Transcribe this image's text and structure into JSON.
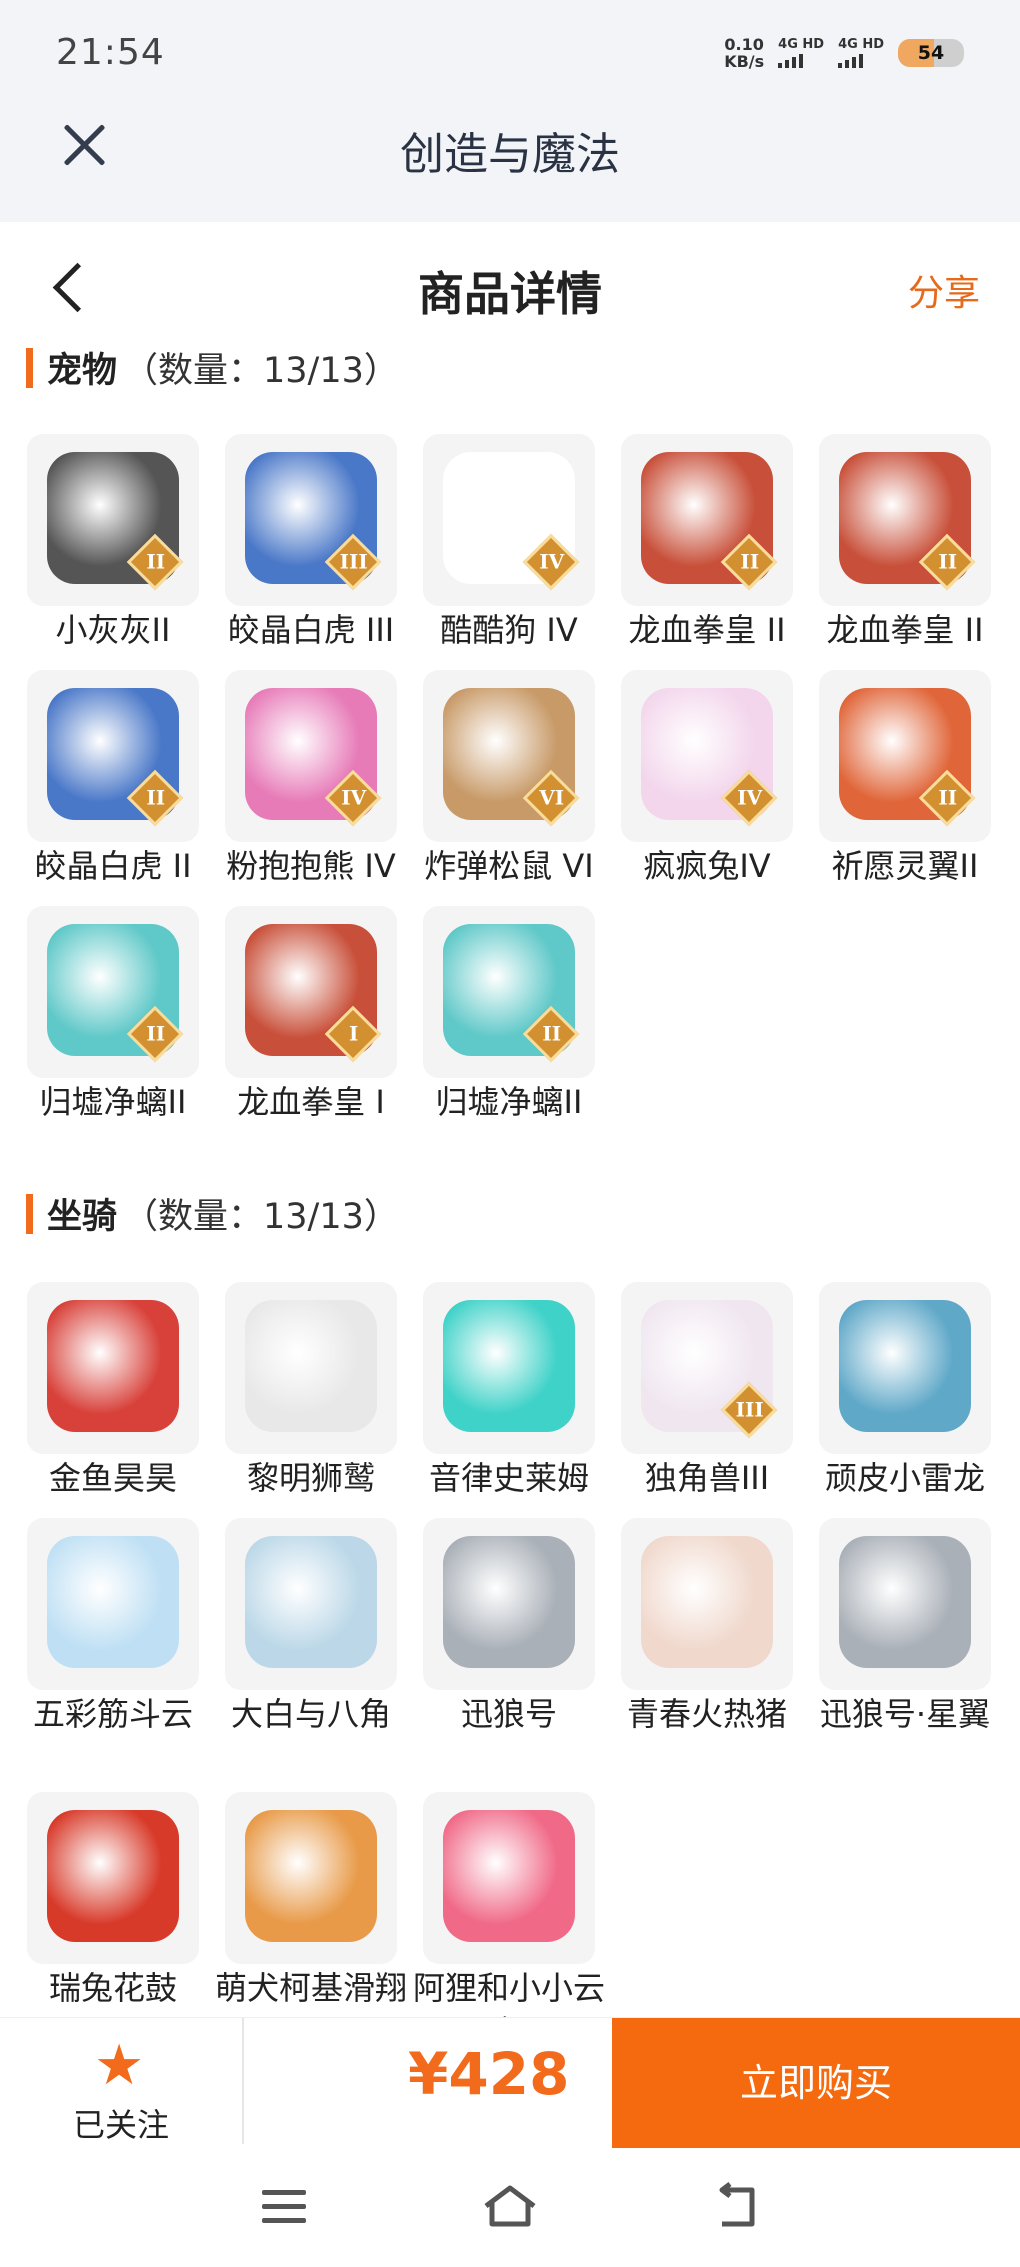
{
  "status_bar": {
    "time": "21:54",
    "net_speed": "0.10",
    "net_unit": "KB/s",
    "signal_1": "4G HD",
    "signal_2": "4G HD",
    "battery": "54",
    "battery_level": 0.54
  },
  "webview": {
    "title": "创造与魔法"
  },
  "header": {
    "title": "商品详情",
    "share": "分享"
  },
  "sections": [
    {
      "name": "宠物",
      "count": "（数量：13/13）",
      "items": [
        {
          "label": "小灰灰II",
          "badge": "II",
          "color": "#555555"
        },
        {
          "label": "皎晶白虎 III",
          "badge": "III",
          "color": "#4a78c8"
        },
        {
          "label": "酷酷狗 IV",
          "badge": "IV",
          "color": "#ffffff"
        },
        {
          "label": "龙血拳皇 II",
          "badge": "II",
          "color": "#c8503a"
        },
        {
          "label": "龙血拳皇 II",
          "badge": "II",
          "color": "#c8503a"
        },
        {
          "label": "皎晶白虎 II",
          "badge": "II",
          "color": "#4a78c8"
        },
        {
          "label": "粉抱抱熊 IV",
          "badge": "IV",
          "color": "#e77bb8"
        },
        {
          "label": "炸弹松鼠 VI",
          "badge": "VI",
          "color": "#c89a68"
        },
        {
          "label": "疯疯兔IV",
          "badge": "IV",
          "color": "#f3d6ec"
        },
        {
          "label": "祈愿灵翼II",
          "badge": "II",
          "color": "#e0663a"
        },
        {
          "label": "归墟净螭II",
          "badge": "II",
          "color": "#5fc8c8"
        },
        {
          "label": "龙血拳皇 I",
          "badge": "I",
          "color": "#c8503a"
        },
        {
          "label": "归墟净螭II",
          "badge": "II",
          "color": "#5fc8c8"
        }
      ]
    },
    {
      "name": "坐骑",
      "count": "（数量：13/13）",
      "items": [
        {
          "label": "金鱼昊昊",
          "badge": "",
          "color": "#d8413a"
        },
        {
          "label": "黎明狮鹫",
          "badge": "",
          "color": "#e8e8e8"
        },
        {
          "label": "音律史莱姆",
          "badge": "",
          "color": "#3fd2c8"
        },
        {
          "label": "独角兽III",
          "badge": "III",
          "color": "#f0e6f0"
        },
        {
          "label": "顽皮小雷龙",
          "badge": "",
          "color": "#5fa8c8"
        },
        {
          "label": "五彩筋斗云",
          "badge": "",
          "color": "#bfe0f4"
        },
        {
          "label": "大白与八角",
          "badge": "",
          "color": "#bcd8e8"
        },
        {
          "label": "迅狼号",
          "badge": "",
          "color": "#aab0b8"
        },
        {
          "label": "青春火热猪",
          "badge": "",
          "color": "#f0d8cc"
        },
        {
          "label": "迅狼号·星翼",
          "badge": "",
          "color": "#aab0b8"
        },
        {
          "label": "瑞兔花鼓",
          "badge": "",
          "color": "#d83a2a"
        },
        {
          "label": "萌犬柯基滑翔翼",
          "badge": "",
          "color": "#e89a48"
        },
        {
          "label": "阿狸和小小云·初",
          "badge": "",
          "color": "#f06a88"
        }
      ]
    }
  ],
  "bottom": {
    "follow": "已关注",
    "price": "¥428",
    "buy": "立即购买",
    "accent": "#f56a0e"
  },
  "nav": {
    "icons": [
      "menu-icon",
      "home-icon",
      "back-icon"
    ]
  }
}
